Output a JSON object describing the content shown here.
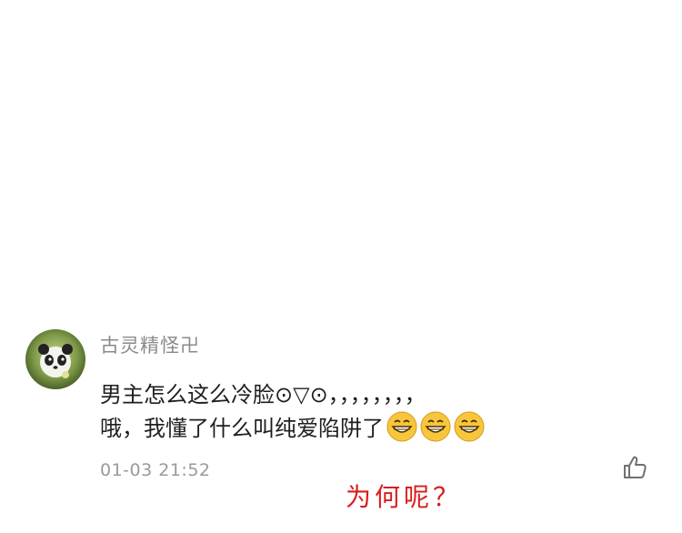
{
  "comment": {
    "username": "古灵精怪卍",
    "text_line1": "男主怎么这么冷脸⊙▽⊙，，，，，，，，",
    "text_line2": "哦，我懂了什么叫纯爱陷阱了",
    "emojis": [
      "grinning-face-icon",
      "grinning-face-icon",
      "grinning-face-icon"
    ],
    "timestamp": "01-03 21:52"
  },
  "annotation": {
    "text": "为何呢？",
    "color": "#d91c1c"
  },
  "colors": {
    "username": "#8a8a8a",
    "body_text": "#1f1f1f",
    "timestamp": "#9a9a9a",
    "emoji_face": "#f7c63c"
  }
}
